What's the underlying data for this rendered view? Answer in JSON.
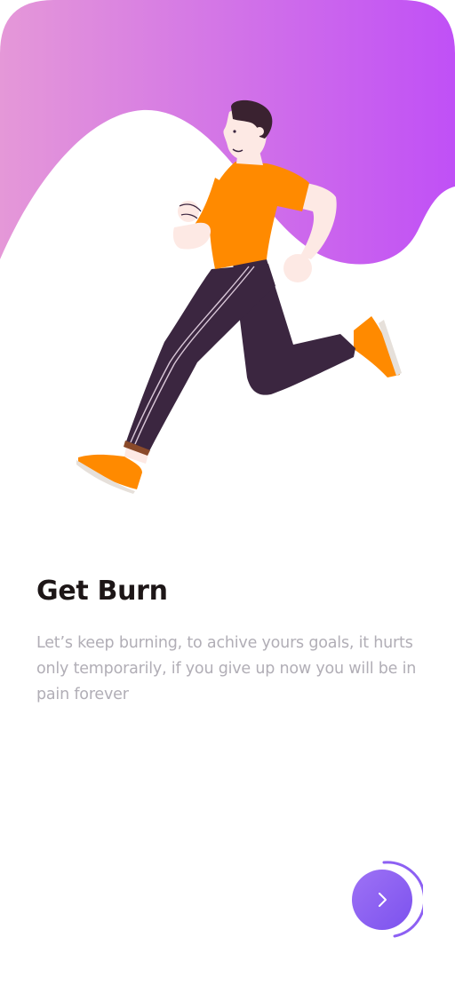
{
  "onboarding": {
    "title": "Get Burn",
    "description": "Let’s keep burning, to achive yours goals, it hurts only temporarily, if you give up now you will be in pain forever",
    "next_button": {
      "icon": "chevron-right-icon"
    },
    "illustration": "running-man-illustration"
  },
  "colors": {
    "gradient_start": "#e598d8",
    "gradient_end": "#c050f6",
    "shirt": "#ff8a00",
    "pants": "#3b2640",
    "skin": "#fde9e4",
    "hair": "#3a2230",
    "accent": "#8d60f3"
  }
}
